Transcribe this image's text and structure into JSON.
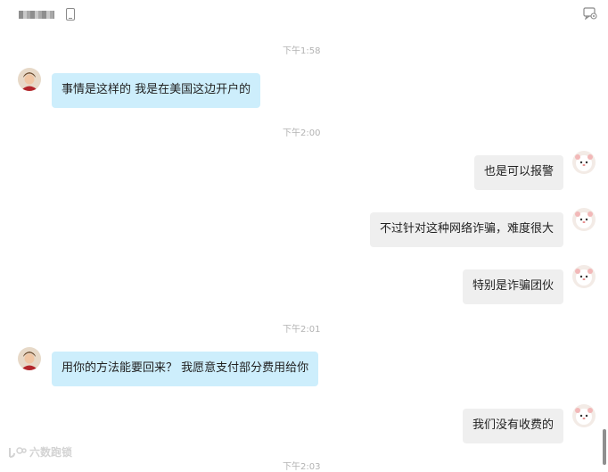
{
  "titlebar": {
    "contact_name_obscured": "",
    "icons": [
      "phone-icon",
      "chat-settings-icon"
    ]
  },
  "messages": [
    {
      "type": "time",
      "text": "下午1:58"
    },
    {
      "type": "message",
      "side": "left",
      "text": "事情是这样的 我是在美国这边开户的"
    },
    {
      "type": "time",
      "text": "下午2:00"
    },
    {
      "type": "message",
      "side": "right",
      "text": "也是可以报警"
    },
    {
      "type": "message",
      "side": "right",
      "text": "不过针对这种网络诈骗，难度很大"
    },
    {
      "type": "message",
      "side": "right",
      "text": "特别是诈骗团伙"
    },
    {
      "type": "time",
      "text": "下午2:01"
    },
    {
      "type": "message",
      "side": "left",
      "text": "用你的方法能要回来？ 我愿意支付部分费用给你"
    },
    {
      "type": "message",
      "side": "right",
      "text": "我们没有收费的"
    },
    {
      "type": "time",
      "text": "下午2:03"
    }
  ],
  "watermark": {
    "text": "六数跑锁"
  },
  "colors": {
    "left_bubble": "#cdeefc",
    "right_bubble": "#efefef",
    "time_text": "#b3b3b3"
  }
}
